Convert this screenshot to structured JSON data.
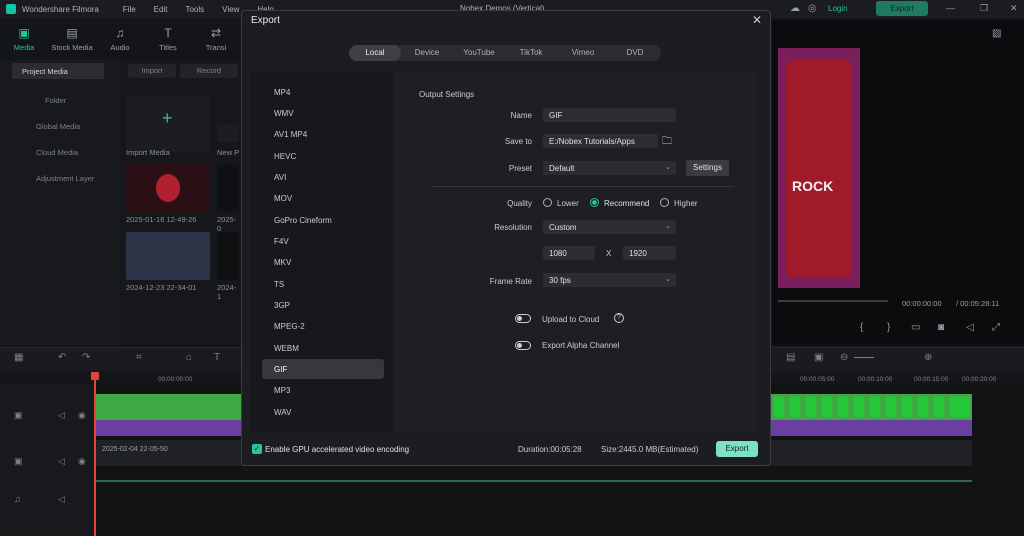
{
  "app": {
    "name": "Wondershare Filmora",
    "project_title": "Nobex Demos (Vertical)",
    "menu": [
      "File",
      "Edit",
      "Tools",
      "View",
      "Help"
    ],
    "login": "Login",
    "export": "Export"
  },
  "toolbar": [
    {
      "label": "Media",
      "icon": "media-icon"
    },
    {
      "label": "Stock Media",
      "icon": "stock-media-icon"
    },
    {
      "label": "Audio",
      "icon": "audio-icon"
    },
    {
      "label": "Titles",
      "icon": "titles-icon"
    },
    {
      "label": "Transi",
      "icon": "transitions-icon"
    }
  ],
  "left_panel": {
    "items": [
      "Project Media",
      "Folder",
      "Global Media",
      "Cloud Media",
      "Adjustment Layer"
    ]
  },
  "media_panel": {
    "import": "Import",
    "record": "Record",
    "import_media": "Import Media",
    "new_label": "New P",
    "clips": [
      "2025-01-16 12-49-26",
      "2025-0",
      "2024-12-23 22-34-01",
      "2024-1"
    ]
  },
  "preview": {
    "current_time": "00:00:00:00",
    "total_time": "/ 00:05:28:11",
    "poster_text": "ROCK"
  },
  "timeline": {
    "ruler": [
      "00:00:00:00",
      "00:00:05:00",
      "00:00:10:00",
      "00:00:15:00",
      "00:00:20:00"
    ],
    "video_clip": "2025-02-04 22-05-50"
  },
  "dialog": {
    "title": "Export",
    "tabs": [
      "Local",
      "Device",
      "YouTube",
      "TikTok",
      "Vimeo",
      "DVD"
    ],
    "active_tab": "Local",
    "formats": [
      "MP4",
      "WMV",
      "AV1 MP4",
      "HEVC",
      "AVI",
      "MOV",
      "GoPro Cineform",
      "F4V",
      "MKV",
      "TS",
      "3GP",
      "MPEG-2",
      "WEBM",
      "GIF",
      "MP3",
      "WAV"
    ],
    "selected_format": "GIF",
    "output_settings_label": "Output Settings",
    "name_label": "Name",
    "name_value": "GIF",
    "save_label": "Save to",
    "save_value": "E:/Nobex Tutorials/Apps",
    "preset_label": "Preset",
    "preset_value": "Default",
    "settings_button": "Settings",
    "quality_label": "Quality",
    "quality_options": [
      "Lower",
      "Recommend",
      "Higher"
    ],
    "quality_selected": "Recommend",
    "resolution_label": "Resolution",
    "resolution_value": "Custom",
    "width": "1080",
    "x": "X",
    "height": "1920",
    "framerate_label": "Frame Rate",
    "framerate_value": "30 fps",
    "upload_cloud": "Upload to Cloud",
    "alpha_channel": "Export Alpha Channel",
    "gpu_label": "Enable GPU accelerated video encoding",
    "duration": "Duration:00:05:28",
    "size": "Size:2445.0 MB(Estimated)",
    "export_button": "Export"
  }
}
